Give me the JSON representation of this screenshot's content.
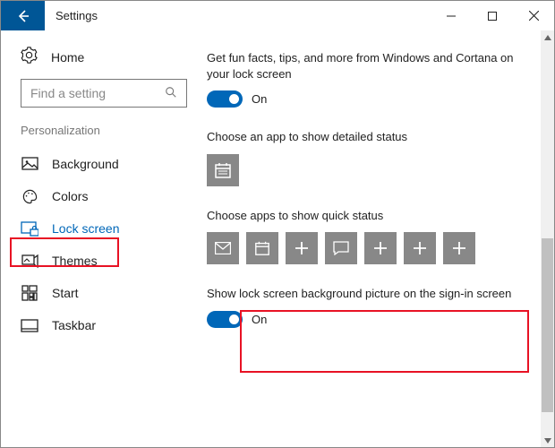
{
  "window": {
    "title": "Settings"
  },
  "sidebar": {
    "home": "Home",
    "search_placeholder": "Find a setting",
    "category": "Personalization",
    "items": [
      {
        "label": "Background"
      },
      {
        "label": "Colors"
      },
      {
        "label": "Lock screen"
      },
      {
        "label": "Themes"
      },
      {
        "label": "Start"
      },
      {
        "label": "Taskbar"
      }
    ]
  },
  "main": {
    "fun_facts": {
      "title": "Get fun facts, tips, and more from Windows and Cortana on your lock screen",
      "state": "On"
    },
    "detailed": {
      "title": "Choose an app to show detailed status"
    },
    "quick": {
      "title": "Choose apps to show quick status"
    },
    "signin_bg": {
      "title": "Show lock screen background picture on the sign-in screen",
      "state": "On"
    }
  }
}
